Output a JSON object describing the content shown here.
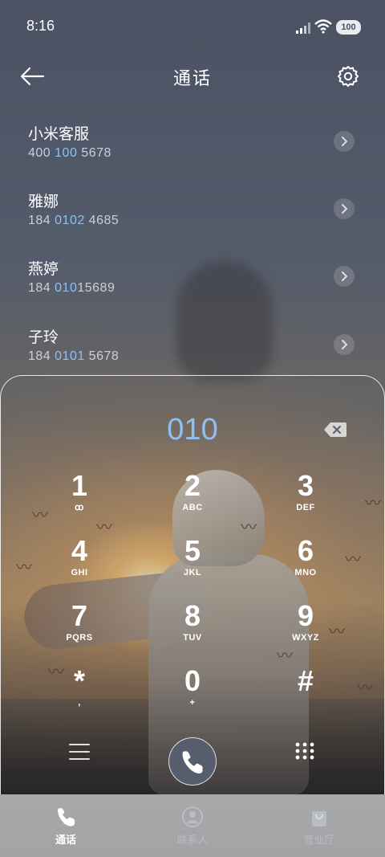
{
  "status_bar": {
    "time": "8:16",
    "battery": "100"
  },
  "header": {
    "title": "通话"
  },
  "contacts": [
    {
      "name": "小米客服",
      "number_pre": "400 ",
      "number_match": "100",
      "number_post": " 5678"
    },
    {
      "name": "雅娜",
      "number_pre": "184 ",
      "number_match": "0102",
      "number_post": " 4685"
    },
    {
      "name": "燕婷",
      "number_pre": "184 ",
      "number_match": "010",
      "number_post": "15689"
    },
    {
      "name": "子玲",
      "number_pre": "184 ",
      "number_match": "0101",
      "number_post": " 5678"
    }
  ],
  "dialer": {
    "entered": "010",
    "keys": [
      {
        "digit": "1",
        "letters": "ꝏ"
      },
      {
        "digit": "2",
        "letters": "ABC"
      },
      {
        "digit": "3",
        "letters": "DEF"
      },
      {
        "digit": "4",
        "letters": "GHI"
      },
      {
        "digit": "5",
        "letters": "JKL"
      },
      {
        "digit": "6",
        "letters": "MNO"
      },
      {
        "digit": "7",
        "letters": "PQRS"
      },
      {
        "digit": "8",
        "letters": "TUV"
      },
      {
        "digit": "9",
        "letters": "WXYZ"
      },
      {
        "digit": "*",
        "letters": ","
      },
      {
        "digit": "0",
        "letters": "+"
      },
      {
        "digit": "#",
        "letters": ""
      }
    ]
  },
  "bottom_nav": [
    {
      "label": "通话",
      "icon": "phone-icon",
      "active": true
    },
    {
      "label": "联系人",
      "icon": "person-icon",
      "active": false
    },
    {
      "label": "营业厅",
      "icon": "bag-icon",
      "active": false
    }
  ],
  "colors": {
    "highlight": "#8fc0f3",
    "nav_active": "#ffffff",
    "nav_inactive": "#b9bcc2"
  }
}
